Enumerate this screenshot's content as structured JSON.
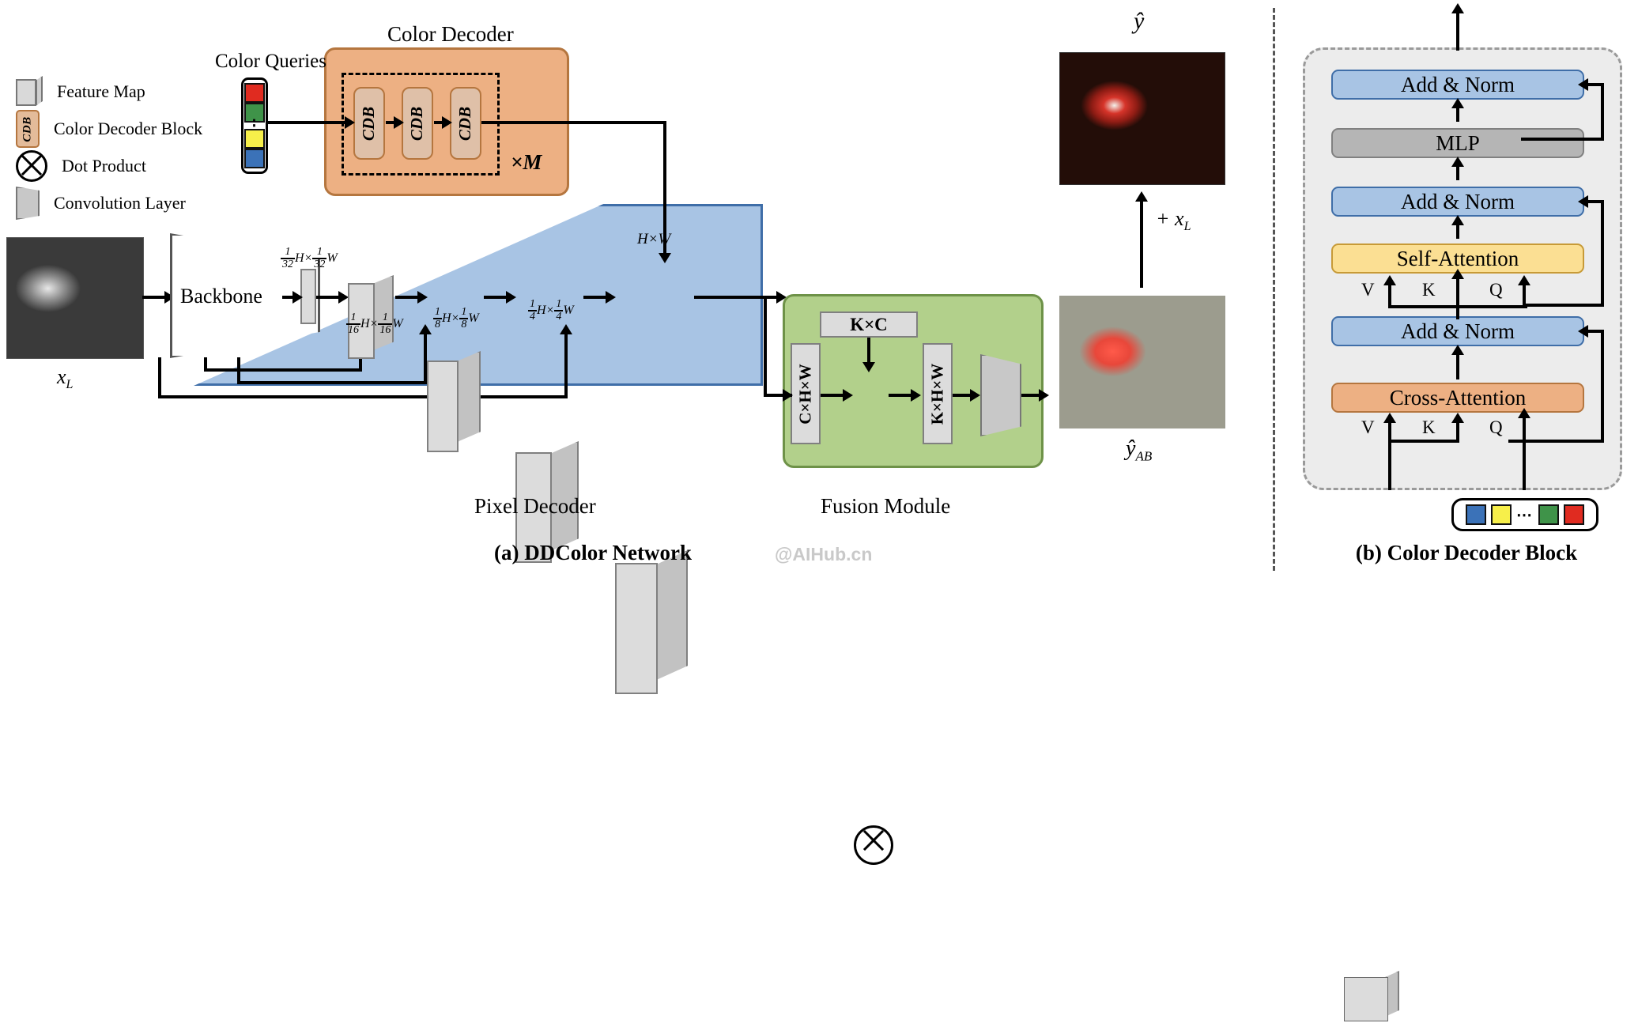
{
  "figure": {
    "watermark": "@AIHub.cn",
    "caption_a": "(a) DDColor Network",
    "caption_b": "(b) Color Decoder Block"
  },
  "legend": {
    "items": [
      {
        "icon": "feature-map-icon",
        "label": "Feature Map"
      },
      {
        "icon": "cdb-icon",
        "label": "Color Decoder Block",
        "glyph": "CDB"
      },
      {
        "icon": "dot-product-icon",
        "label": "Dot Product"
      },
      {
        "icon": "convolution-layer-icon",
        "label": "Convolution Layer"
      }
    ]
  },
  "network": {
    "input_image_label": "x_L",
    "input_image_label_html": "x",
    "input_image_sub": "L",
    "backbone_label": "Backbone",
    "color_queries_title": "Color Queries",
    "color_queries_swatches": [
      "#e02b20",
      "#3f9349",
      "dots",
      "#f7ef4a",
      "#3b72b8"
    ],
    "color_decoder_title": "Color Decoder",
    "cdb_blocks": [
      "CDB",
      "CDB",
      "CDB"
    ],
    "repeat_label": "×M",
    "pixel_decoder_title": "Pixel Decoder",
    "feature_map_labels": [
      {
        "num": "1",
        "den": "32",
        "text": "H×",
        "num2": "1",
        "den2": "32",
        "text2": "W"
      },
      {
        "num": "1",
        "den": "16",
        "text": "H×",
        "num2": "1",
        "den2": "16",
        "text2": "W"
      },
      {
        "num": "1",
        "den": "8",
        "text": "H×",
        "num2": "1",
        "den2": "8",
        "text2": "W"
      },
      {
        "num": "1",
        "den": "4",
        "text": "H×",
        "num2": "1",
        "den2": "4",
        "text2": "W"
      }
    ],
    "full_res_label": "H×W",
    "fusion_title": "Fusion Module",
    "fusion_kc": "K×C",
    "fusion_chw": "C×H×W",
    "fusion_khw": "K×H×W",
    "output_y_hat": "ŷ",
    "output_y_ab": "ŷ",
    "output_y_ab_sub": "AB",
    "residual_label": "+ x",
    "residual_sub": "L"
  },
  "color_decoder_block": {
    "blocks": [
      {
        "name": "add-norm-top",
        "label": "Add & Norm",
        "color": "#a8c4e4"
      },
      {
        "name": "mlp",
        "label": "MLP",
        "color": "#b5b5b5"
      },
      {
        "name": "add-norm-mid",
        "label": "Add & Norm",
        "color": "#a8c4e4"
      },
      {
        "name": "self-attention",
        "label": "Self-Attention",
        "color": "#fbdf93"
      },
      {
        "name": "add-norm-bottom",
        "label": "Add & Norm",
        "color": "#a8c4e4"
      },
      {
        "name": "cross-attention",
        "label": "Cross-Attention",
        "color": "#edb083"
      }
    ],
    "self_attn_inputs": [
      "V",
      "K",
      "Q"
    ],
    "cross_attn_inputs": [
      "V",
      "K",
      "Q"
    ],
    "query_swatches": [
      "#3b72b8",
      "#f7ef4a",
      "dots",
      "#3f9349",
      "#e02b20"
    ]
  },
  "colors": {
    "orange_panel": "#edb083",
    "orange_border": "#b5763f",
    "blue_panel": "#a8c4e4",
    "blue_border": "#3f6ea8",
    "green_panel": "#b2d08b",
    "green_border": "#6e9248",
    "gray_box": "#dcdcdc",
    "yellow_box": "#fbdf93"
  }
}
